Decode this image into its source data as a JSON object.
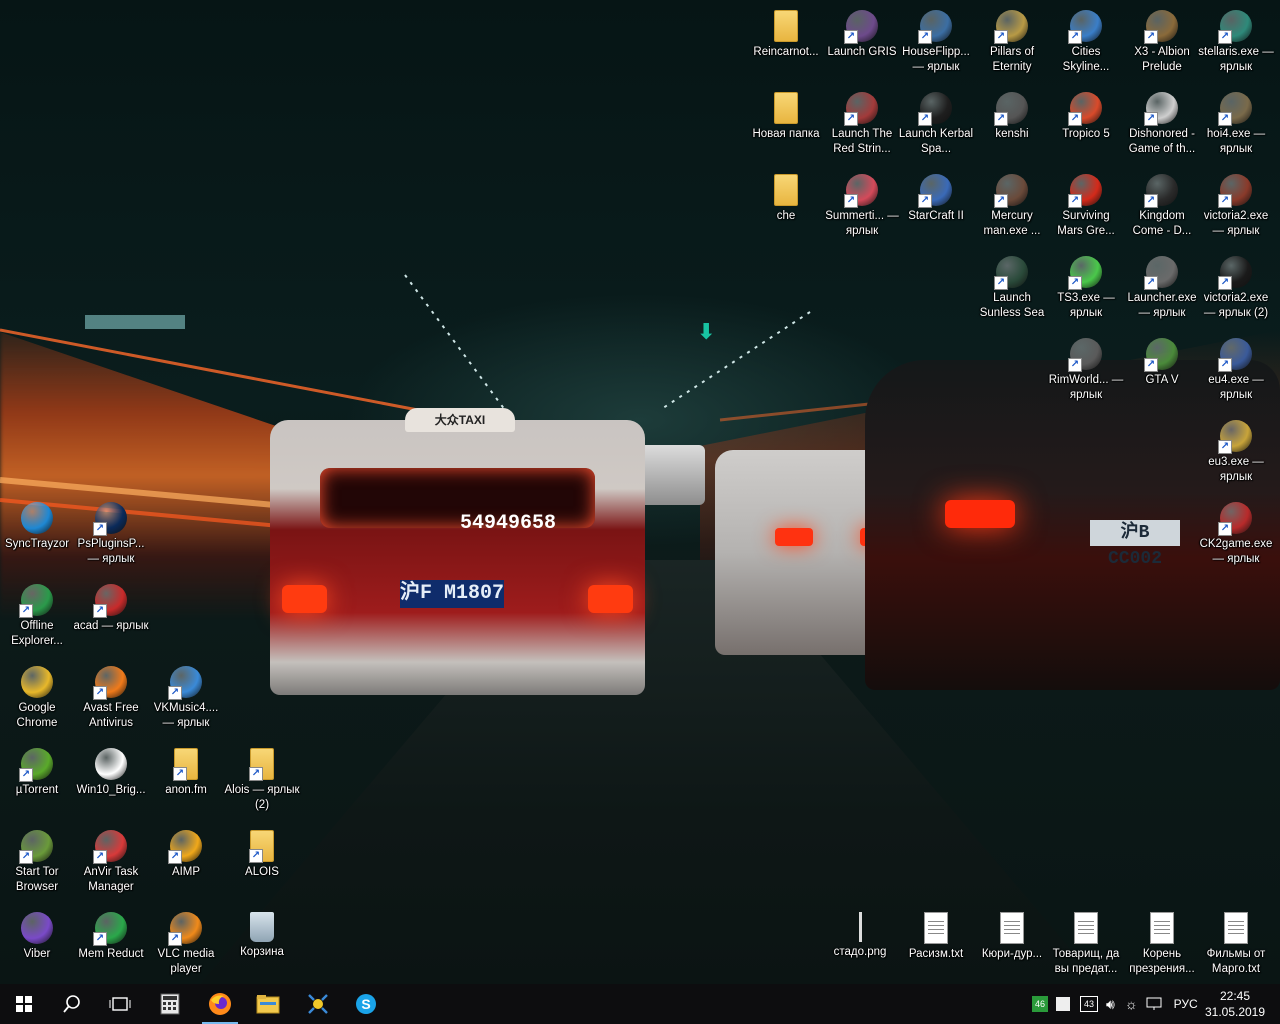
{
  "desktop": {
    "icons": [
      {
        "id": "reincarnot",
        "label": "Reincarnot...",
        "kind": "folder",
        "shortcut": false
      },
      {
        "id": "launch-gris",
        "label": "Launch GRIS",
        "kind": "app",
        "shortcut": true,
        "color": "#6d4a8b"
      },
      {
        "id": "houseflipper",
        "label": "HouseFlipp... — ярлык",
        "kind": "app",
        "shortcut": true,
        "color": "#3b6ea3"
      },
      {
        "id": "pillars",
        "label": "Pillars of Eternity",
        "kind": "app",
        "shortcut": true,
        "color": "#b89a45"
      },
      {
        "id": "cities",
        "label": "Cities Skyline...",
        "kind": "app",
        "shortcut": true,
        "color": "#3a7ec8"
      },
      {
        "id": "x3",
        "label": "X3 - Albion Prelude",
        "kind": "app",
        "shortcut": true,
        "color": "#8a6a3a"
      },
      {
        "id": "stellaris",
        "label": "stellaris.exe — ярлык",
        "kind": "app",
        "shortcut": true,
        "color": "#2e8a7a"
      },
      {
        "id": "new-folder",
        "label": "Новая папка",
        "kind": "folder",
        "shortcut": false
      },
      {
        "id": "red-strings",
        "label": "Launch The Red Strin...",
        "kind": "app",
        "shortcut": true,
        "color": "#a23a3a"
      },
      {
        "id": "kerbal",
        "label": "Launch Kerbal Spa...",
        "kind": "app",
        "shortcut": true,
        "color": "#1e1e1e"
      },
      {
        "id": "kenshi",
        "label": "kenshi",
        "kind": "app",
        "shortcut": true,
        "color": "#555555"
      },
      {
        "id": "tropico",
        "label": "Tropico 5",
        "kind": "app",
        "shortcut": true,
        "color": "#d94a2a"
      },
      {
        "id": "dishonored",
        "label": "Dishonored - Game of th...",
        "kind": "app",
        "shortcut": true,
        "color": "#cfcfcf"
      },
      {
        "id": "hoi4",
        "label": "hoi4.exe — ярлык",
        "kind": "app",
        "shortcut": true,
        "color": "#7a6a4a"
      },
      {
        "id": "che",
        "label": "che",
        "kind": "folder",
        "shortcut": false
      },
      {
        "id": "summertime",
        "label": "Summerti... — ярлык",
        "kind": "app",
        "shortcut": true,
        "color": "#d44a5a"
      },
      {
        "id": "starcraft",
        "label": "StarCraft II",
        "kind": "app",
        "shortcut": true,
        "color": "#3a6ab8"
      },
      {
        "id": "mercury",
        "label": "Mercury man.exe ...",
        "kind": "app",
        "shortcut": true,
        "color": "#6a4a3a"
      },
      {
        "id": "surviving",
        "label": "Surviving Mars Gre...",
        "kind": "app",
        "shortcut": true,
        "color": "#d42a1a"
      },
      {
        "id": "kingdom",
        "label": "Kingdom Come - D...",
        "kind": "app",
        "shortcut": true,
        "color": "#2a2a2a"
      },
      {
        "id": "victoria2",
        "label": "victoria2.exe — ярлык",
        "kind": "app",
        "shortcut": true,
        "color": "#8a3a2a"
      },
      {
        "id": "sunless",
        "label": "Launch Sunless Sea",
        "kind": "app",
        "shortcut": true,
        "color": "#2a4a3a"
      },
      {
        "id": "ts3",
        "label": "TS3.exe — ярлык",
        "kind": "app",
        "shortcut": true,
        "color": "#4ac84a"
      },
      {
        "id": "launcher",
        "label": "Launcher.exe — ярлык",
        "kind": "app",
        "shortcut": true,
        "color": "#6a6a6a"
      },
      {
        "id": "victoria2-2",
        "label": "victoria2.exe — ярлык (2)",
        "kind": "app",
        "shortcut": true,
        "color": "#1a1a1a"
      },
      {
        "id": "rimworld",
        "label": "RimWorld... — ярлык",
        "kind": "app",
        "shortcut": true,
        "color": "#5a5a5a"
      },
      {
        "id": "gta",
        "label": "GTA V",
        "kind": "app",
        "shortcut": true,
        "color": "#4a8a3a"
      },
      {
        "id": "eu4",
        "label": "eu4.exe — ярлык",
        "kind": "app",
        "shortcut": true,
        "color": "#3a5a9a"
      },
      {
        "id": "eu3",
        "label": "eu3.exe — ярлык",
        "kind": "app",
        "shortcut": true,
        "color": "#c8a43a"
      },
      {
        "id": "ck2",
        "label": "CK2game.exe — ярлык",
        "kind": "app",
        "shortcut": true,
        "color": "#b82a2a"
      },
      {
        "id": "synctrayzor",
        "label": "SyncTrayzor",
        "kind": "app",
        "shortcut": false,
        "color": "#1e88d4"
      },
      {
        "id": "psplugins",
        "label": "PsPluginsP... — ярлык",
        "kind": "app",
        "shortcut": true,
        "color": "#0a2a5a"
      },
      {
        "id": "offline-explorer",
        "label": "Offline Explorer...",
        "kind": "app",
        "shortcut": true,
        "color": "#2a9a4a"
      },
      {
        "id": "acad",
        "label": "acad — ярлык",
        "kind": "app",
        "shortcut": true,
        "color": "#c82a2a"
      },
      {
        "id": "chrome",
        "label": "Google Chrome",
        "kind": "app",
        "shortcut": false,
        "color": "#e8b82a"
      },
      {
        "id": "avast",
        "label": "Avast Free Antivirus",
        "kind": "app",
        "shortcut": true,
        "color": "#f07a1a"
      },
      {
        "id": "vkmusic",
        "label": "VKMusic4.... — ярлык",
        "kind": "app",
        "shortcut": true,
        "color": "#3a8ad8"
      },
      {
        "id": "utorrent",
        "label": "µTorrent",
        "kind": "app",
        "shortcut": true,
        "color": "#5aaa2a"
      },
      {
        "id": "win10-bright",
        "label": "Win10_Brig...",
        "kind": "app",
        "shortcut": false,
        "color": "#ffffff"
      },
      {
        "id": "anonfm",
        "label": "anon.fm",
        "kind": "folder",
        "shortcut": true
      },
      {
        "id": "alois-2",
        "label": "Alois — ярлык (2)",
        "kind": "folder",
        "shortcut": true
      },
      {
        "id": "tor",
        "label": "Start Tor Browser",
        "kind": "app",
        "shortcut": true,
        "color": "#6a9a3a"
      },
      {
        "id": "anvir",
        "label": "AnVir Task Manager",
        "kind": "app",
        "shortcut": true,
        "color": "#d83a3a"
      },
      {
        "id": "aimp",
        "label": "AIMP",
        "kind": "app",
        "shortcut": true,
        "color": "#f0a81a"
      },
      {
        "id": "alois",
        "label": "ALOIS",
        "kind": "folder",
        "shortcut": true
      },
      {
        "id": "viber",
        "label": "Viber",
        "kind": "app",
        "shortcut": false,
        "color": "#7a4ac8"
      },
      {
        "id": "memreduct",
        "label": "Mem Reduct",
        "kind": "app",
        "shortcut": true,
        "color": "#2aa84a"
      },
      {
        "id": "vlc",
        "label": "VLC media player",
        "kind": "app",
        "shortcut": true,
        "color": "#f08a1a"
      },
      {
        "id": "recycle",
        "label": "Корзина",
        "kind": "recycle",
        "shortcut": false
      },
      {
        "id": "stado",
        "label": "стадо.png",
        "kind": "image",
        "shortcut": false
      },
      {
        "id": "rasizm",
        "label": "Расизм.txt",
        "kind": "doc",
        "shortcut": false
      },
      {
        "id": "kyuri",
        "label": "Кюри-дур...",
        "kind": "doc",
        "shortcut": false
      },
      {
        "id": "tovarisch",
        "label": "Товарищ, да вы предат...",
        "kind": "doc",
        "shortcut": false
      },
      {
        "id": "koren",
        "label": "Корень презрения...",
        "kind": "doc",
        "shortcut": false
      },
      {
        "id": "filmy",
        "label": "Фильмы от Марго.txt",
        "kind": "doc",
        "shortcut": false
      }
    ]
  },
  "wallpaper": {
    "taxi_plate": "沪F M1807",
    "taxi_sign": "大众TAXI",
    "van_plate": "沪B CC002",
    "taxi_number": "54949658"
  },
  "taskbar": {
    "pinned": [
      {
        "id": "start",
        "icon": "windows-logo-icon"
      },
      {
        "id": "search",
        "icon": "search-icon"
      },
      {
        "id": "task-view",
        "icon": "task-view-icon"
      },
      {
        "id": "calculator",
        "icon": "calculator-icon"
      },
      {
        "id": "firefox",
        "icon": "firefox-icon",
        "active": true
      },
      {
        "id": "explorer",
        "icon": "folder-icon"
      },
      {
        "id": "network-app",
        "icon": "network-app-icon"
      },
      {
        "id": "skype",
        "icon": "skype-icon"
      }
    ],
    "tray": {
      "badge_1": "46",
      "badge_2": "43",
      "language": "РУС"
    },
    "clock": {
      "time": "22:45",
      "date": "31.05.2019"
    }
  }
}
